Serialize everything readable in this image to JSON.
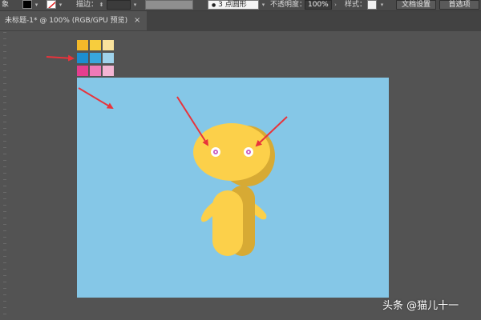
{
  "toolbar": {
    "left_edge_text": "象",
    "stroke_label": "描边：",
    "brush_profile": "3 点圆形",
    "opacity_label": "不透明度：",
    "opacity_value": "100%",
    "style_label": "样式：",
    "doc_setup_button": "文档设置",
    "preferences_button": "首选项"
  },
  "document": {
    "tab_title": "未标题-1* @ 100% (RGB/GPU 预览)",
    "close_glyph": "×"
  },
  "swatches": [
    [
      "#f3b92a",
      "#f7cd3d",
      "#f9e29c"
    ],
    [
      "#1b8ed0",
      "#38a7dd",
      "#9fd3ec"
    ],
    [
      "#e43e8f",
      "#ee7ab8",
      "#f3b5d4"
    ]
  ],
  "colors": {
    "artboard": "#85c7e7",
    "body_light": "#fcd04a",
    "body_shadow": "#d7aa34",
    "eye_white": "#ffffff",
    "eye_iris": "#c85cc0",
    "arrow": "#e8333b"
  },
  "watermark": "头条 @猫儿十一"
}
